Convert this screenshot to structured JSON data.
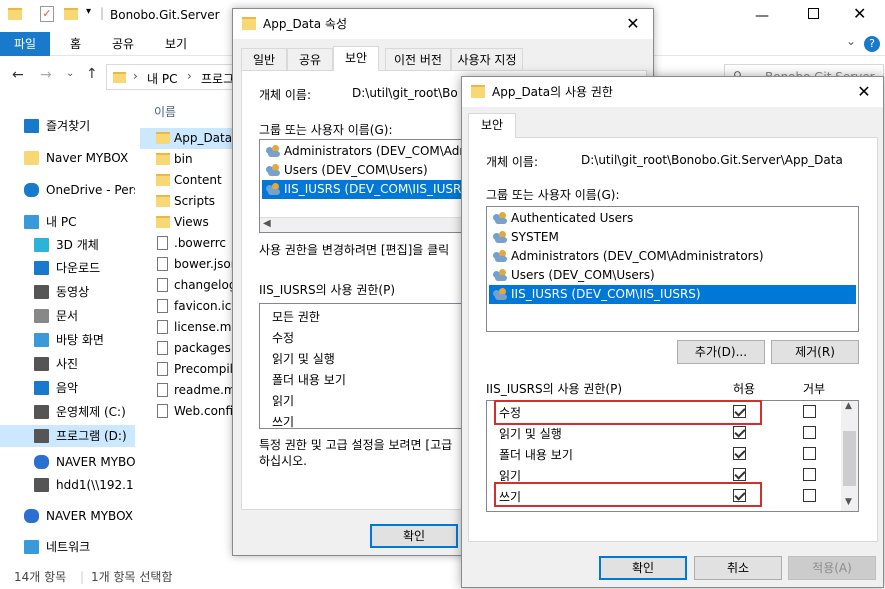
{
  "explorer": {
    "title": "Bonobo.Git.Server",
    "ribbon_tabs": [
      "파일",
      "홈",
      "공유",
      "보기"
    ],
    "breadcrumb": [
      "내 PC",
      "프로그"
    ],
    "search_placeholder": "Bonobo.Git.Server",
    "column_name": "이름",
    "nav": [
      {
        "label": "즐겨찾기",
        "icon": "star-icon"
      },
      {
        "label": "Naver MYBOX",
        "icon": "folder-icon"
      },
      {
        "label": "OneDrive - Pers",
        "icon": "cloud-icon"
      },
      {
        "label": "내 PC",
        "icon": "pc-icon"
      },
      {
        "label": "3D 개체",
        "icon": "cube-icon"
      },
      {
        "label": "다운로드",
        "icon": "download-icon"
      },
      {
        "label": "동영상",
        "icon": "video-icon"
      },
      {
        "label": "문서",
        "icon": "document-icon"
      },
      {
        "label": "바탕 화면",
        "icon": "desktop-icon"
      },
      {
        "label": "사진",
        "icon": "picture-icon"
      },
      {
        "label": "음악",
        "icon": "music-icon"
      },
      {
        "label": "운영체제 (C:)",
        "icon": "drive-icon"
      },
      {
        "label": "프로그램 (D:)",
        "icon": "drive-icon"
      },
      {
        "label": "NAVER MYBOX",
        "icon": "mybox-icon"
      },
      {
        "label": "hdd1(\\\\192.1",
        "icon": "network-drive-icon"
      },
      {
        "label": "NAVER MYBOX",
        "icon": "mybox-icon"
      },
      {
        "label": "네트워크",
        "icon": "network-icon"
      }
    ],
    "files": [
      {
        "name": "App_Data",
        "type": "folder"
      },
      {
        "name": "bin",
        "type": "folder"
      },
      {
        "name": "Content",
        "type": "folder"
      },
      {
        "name": "Scripts",
        "type": "folder"
      },
      {
        "name": "Views",
        "type": "folder"
      },
      {
        "name": ".bowerrc",
        "type": "file"
      },
      {
        "name": "bower.json",
        "type": "file"
      },
      {
        "name": "changelog.",
        "type": "file"
      },
      {
        "name": "favicon.ico",
        "type": "file"
      },
      {
        "name": "license.md",
        "type": "file"
      },
      {
        "name": "packages.c",
        "type": "file"
      },
      {
        "name": "Precompile",
        "type": "file"
      },
      {
        "name": "readme.mc",
        "type": "file"
      },
      {
        "name": "Web.config",
        "type": "file"
      }
    ],
    "status_items": "14개 항목",
    "status_selected": "1개 항목 선택함"
  },
  "props_dialog": {
    "title": "App_Data 속성",
    "tabs": [
      "일반",
      "공유",
      "보안",
      "이전 버전",
      "사용자 지정"
    ],
    "object_label": "개체 이름:",
    "object_value": "D:\\util\\git_root\\Bo",
    "group_label": "그룹 또는 사용자 이름(G):",
    "users": [
      "Administrators (DEV_COM\\Admi",
      "Users (DEV_COM\\Users)",
      "IIS_IUSRS (DEV_COM\\IIS_IUSRS)"
    ],
    "change_text": "사용 권한을 변경하려면 [편집]을 클릭",
    "perm_label": "IIS_IUSRS의 사용 권한(P)",
    "perms": [
      "모든 권한",
      "수정",
      "읽기 및 실행",
      "폴더 내용 보기",
      "읽기",
      "쓰기"
    ],
    "advanced_text_1": "특정 권한 및 고급 설정을 보려면 [고급",
    "advanced_text_2": "하십시오.",
    "ok": "확인"
  },
  "perm_dialog": {
    "title": "App_Data의 사용 권한",
    "tab": "보안",
    "object_label": "개체 이름:",
    "object_value": "D:\\util\\git_root\\Bonobo.Git.Server\\App_Data",
    "group_label": "그룹 또는 사용자 이름(G):",
    "users": [
      "Authenticated Users",
      "SYSTEM",
      "Administrators (DEV_COM\\Administrators)",
      "Users (DEV_COM\\Users)",
      "IIS_IUSRS (DEV_COM\\IIS_IUSRS)"
    ],
    "add_button": "추가(D)...",
    "remove_button": "제거(R)",
    "perm_label": "IIS_IUSRS의 사용 권한(P)",
    "allow_header": "허용",
    "deny_header": "거부",
    "perms": [
      {
        "name": "수정",
        "allow": true,
        "deny": false
      },
      {
        "name": "읽기 및 실행",
        "allow": true,
        "deny": false
      },
      {
        "name": "폴더 내용 보기",
        "allow": true,
        "deny": false
      },
      {
        "name": "읽기",
        "allow": true,
        "deny": false
      },
      {
        "name": "쓰기",
        "allow": true,
        "deny": false
      }
    ],
    "ok": "확인",
    "cancel": "취소",
    "apply": "적용(A)"
  },
  "colors": {
    "accent": "#0078d7",
    "ribbon_file": "#1979ca",
    "selection": "#cce8ff",
    "highlight_box": "#d32f2f"
  }
}
